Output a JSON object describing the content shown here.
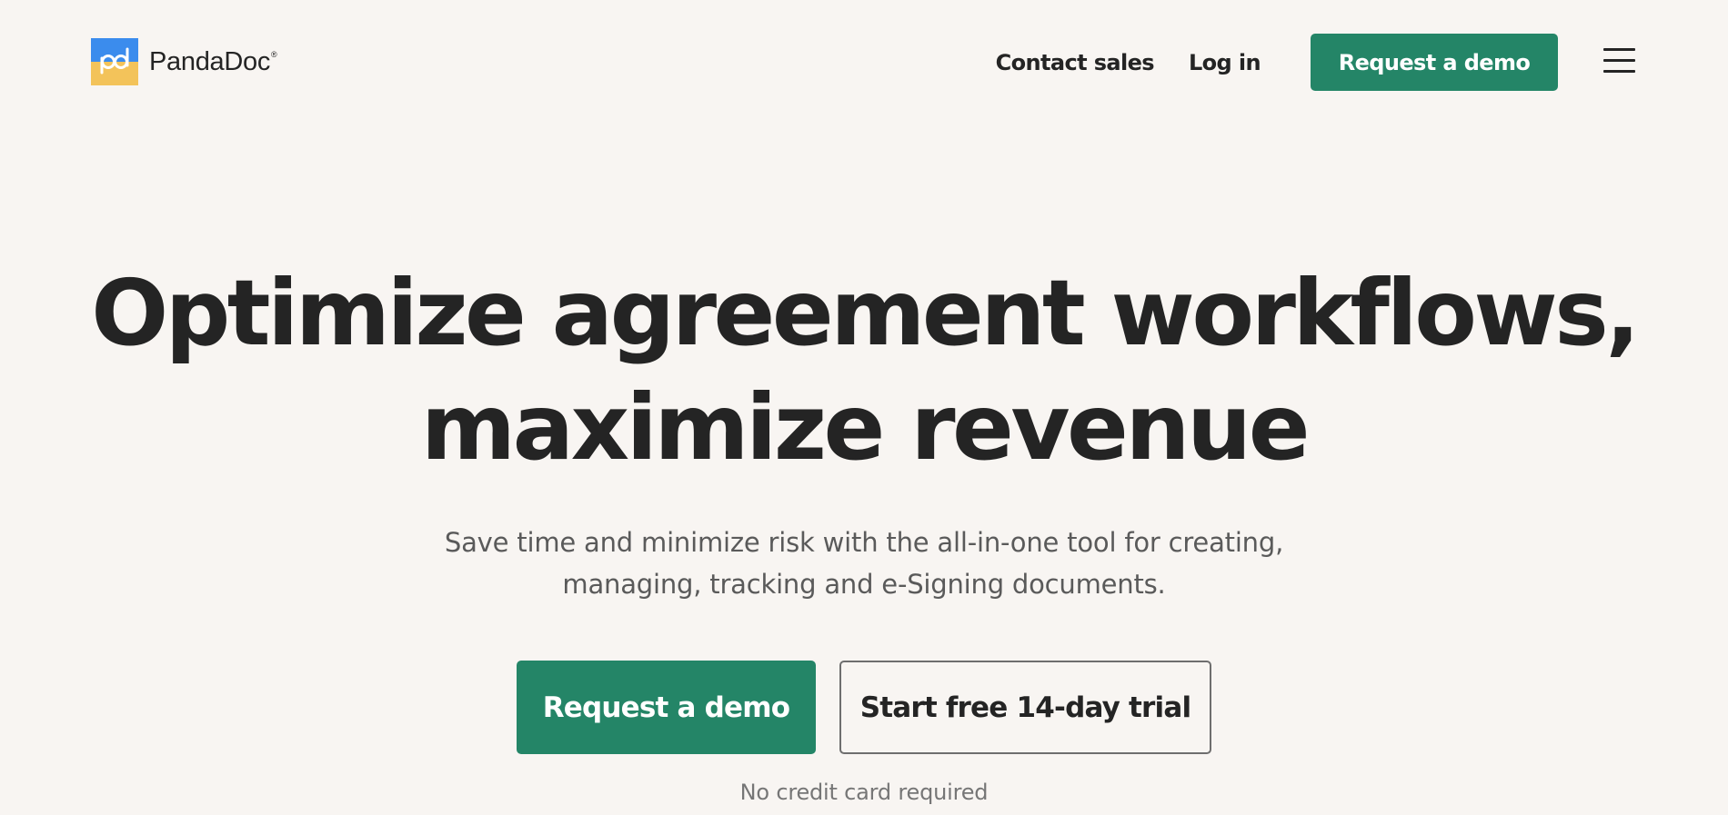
{
  "header": {
    "logo_text": "PandaDoc",
    "logo_registered": "®",
    "logo_icon": "pandadoc-logo-icon",
    "nav": {
      "contact_sales": "Contact sales",
      "log_in": "Log in",
      "request_demo": "Request a demo"
    },
    "menu_icon": "hamburger-menu-icon"
  },
  "hero": {
    "title_line1": "Optimize agreement workflows,",
    "title_line2": "maximize revenue",
    "subtitle_line1": "Save time and minimize risk with the all-in-one tool for creating,",
    "subtitle_line2": "managing, tracking and e-Signing documents.",
    "primary_cta": "Request a demo",
    "secondary_cta": "Start free 14-day trial",
    "note": "No credit card required"
  },
  "colors": {
    "background": "#f8f5f2",
    "brand_green": "#248567",
    "text_dark": "#242424",
    "text_muted": "#5a5a5a",
    "logo_blue": "#3b8ced",
    "logo_yellow": "#f3c35a"
  }
}
